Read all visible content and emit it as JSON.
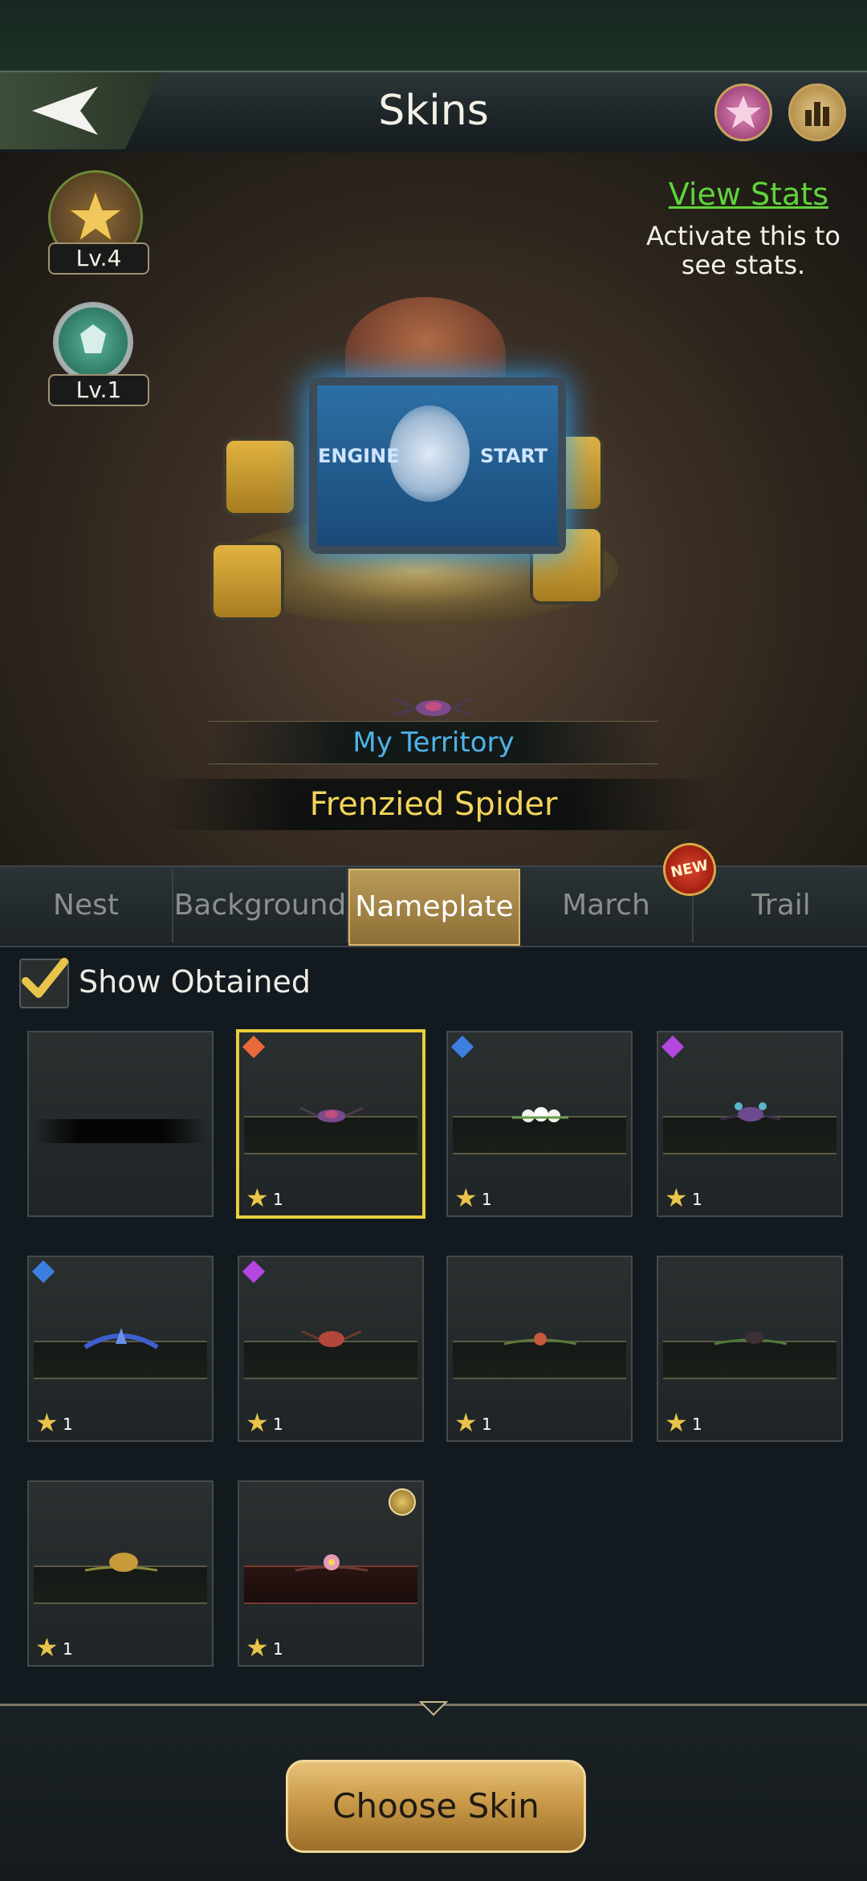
{
  "header": {
    "title": "Skins",
    "back_icon": "back-arrow-icon",
    "right_icons": [
      "rose-emblem-icon",
      "stats-icon"
    ]
  },
  "profile": {
    "badges": [
      {
        "level": "Lv.4",
        "icon": "star-medal-icon"
      },
      {
        "level": "Lv.1",
        "icon": "ant-shield-medal-icon"
      }
    ],
    "view_stats": "View Stats",
    "activate_hint": "Activate this to see stats."
  },
  "preview": {
    "screen_left": "ENGINE",
    "screen_right": "START",
    "territory_label": "My Territory",
    "skin_name": "Frenzied Spider"
  },
  "tabs": [
    {
      "label": "Nest",
      "active": false
    },
    {
      "label": "Background",
      "active": false
    },
    {
      "label": "Nameplate",
      "active": true
    },
    {
      "label": "March",
      "active": false,
      "badge": "NEW"
    },
    {
      "label": "Trail",
      "active": false
    }
  ],
  "filter": {
    "show_obtained_label": "Show Obtained",
    "show_obtained_checked": true
  },
  "grid": [
    {
      "name": "default-nameplate",
      "gem": null,
      "stars": ""
    },
    {
      "name": "frenzied-spider-nameplate",
      "gem": "orange",
      "stars": "1",
      "selected": true
    },
    {
      "name": "white-flower-nameplate",
      "gem": "blue",
      "stars": "1"
    },
    {
      "name": "purple-spider-nameplate",
      "gem": "purple",
      "stars": "1"
    },
    {
      "name": "blue-wing-nameplate",
      "gem": "blue",
      "stars": "1"
    },
    {
      "name": "red-beetle-nameplate",
      "gem": "purple",
      "stars": "1"
    },
    {
      "name": "vine-flower-nameplate",
      "gem": null,
      "stars": "1"
    },
    {
      "name": "dark-beetle-nameplate",
      "gem": null,
      "stars": "1"
    },
    {
      "name": "golden-turtle-nameplate",
      "gem": null,
      "stars": "1"
    },
    {
      "name": "pink-blossom-nameplate",
      "gem": null,
      "stars": "1",
      "coin": true
    }
  ],
  "colors": {
    "gem_orange": "#e86a3a",
    "gem_blue": "#3d7fe0",
    "gem_purple": "#b347e0",
    "accent_gold": "#e7cf3a",
    "link_green": "#5fd43b"
  },
  "footer": {
    "choose_label": "Choose Skin"
  }
}
